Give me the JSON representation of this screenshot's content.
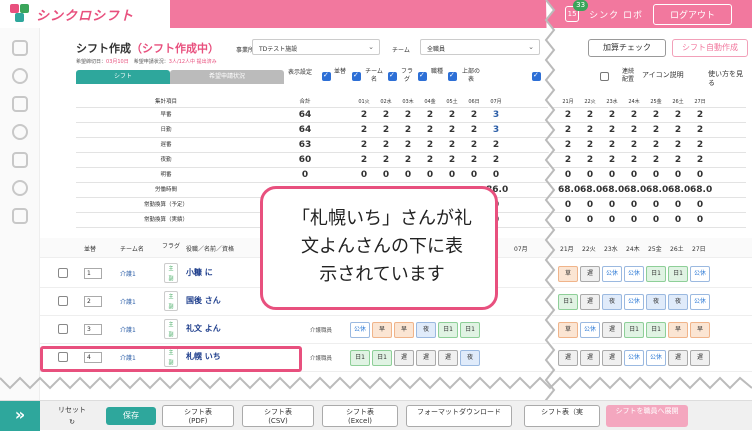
{
  "header": {
    "logo": "シンクロシフト",
    "notification_count": "33",
    "notification_label": "15",
    "user_name": "シンク ロボ",
    "logout": "ログアウト"
  },
  "toolbar": {
    "title": "シフト作成",
    "status": "（シフト作成中）",
    "office_label": "事業所",
    "office_value": "TDテスト施設",
    "team_label": "チーム",
    "team_value": "全職員",
    "deadline_label": "希望締切日：",
    "deadline_value": "03月10日",
    "request_label": "希望申請状況：",
    "request_value": "3人/12人中 提出済み",
    "tab_shift": "シフト",
    "tab_request": "希望申請状況",
    "display_label": "表示設定",
    "display_options": [
      "並替",
      "チーム名",
      "フラグ",
      "職種",
      "上部の表"
    ],
    "check_button": "加算チェック",
    "auto_button": "シフト自動作成",
    "fixed_label": "連続配置",
    "icon_label": "アイコン説明",
    "help_label": "使い方を見る"
  },
  "summary": {
    "header": {
      "label": "集計項目",
      "total": "合計"
    },
    "days": [
      "01火",
      "02水",
      "03木",
      "04金",
      "05土",
      "06日",
      "07月"
    ],
    "days_right": [
      "21月",
      "22火",
      "23水",
      "24木",
      "25金",
      "26土",
      "27日"
    ],
    "rows": [
      {
        "label": "早番",
        "total": "64",
        "values": [
          "2",
          "2",
          "2",
          "2",
          "2",
          "2",
          "3"
        ],
        "right": [
          "2",
          "2",
          "2",
          "2",
          "2",
          "2",
          "2"
        ]
      },
      {
        "label": "日勤",
        "total": "64",
        "values": [
          "2",
          "2",
          "2",
          "2",
          "2",
          "2",
          "3"
        ],
        "right": [
          "2",
          "2",
          "2",
          "2",
          "2",
          "2",
          "2"
        ]
      },
      {
        "label": "遅番",
        "total": "63",
        "values": [
          "2",
          "2",
          "2",
          "2",
          "2",
          "2",
          "2"
        ],
        "right": [
          "2",
          "2",
          "2",
          "2",
          "2",
          "2",
          "2"
        ]
      },
      {
        "label": "夜勤",
        "total": "60",
        "values": [
          "2",
          "2",
          "2",
          "2",
          "2",
          "2",
          "2"
        ],
        "right": [
          "2",
          "2",
          "2",
          "2",
          "2",
          "2",
          "2"
        ]
      },
      {
        "label": "明番",
        "total": "0",
        "values": [
          "0",
          "0",
          "0",
          "0",
          "0",
          "0",
          "0"
        ],
        "right": [
          "0",
          "0",
          "0",
          "0",
          "0",
          "0",
          "0"
        ]
      },
      {
        "label": "労働時間",
        "total": "",
        "values": [
          "",
          "",
          "",
          "",
          "",
          "",
          "86.0"
        ],
        "right": [
          "68.0",
          "68.0",
          "68.0",
          "68.0",
          "68.0",
          "68.0",
          "68.0"
        ]
      },
      {
        "label": "常勤換算（予定）",
        "total": "",
        "values": [
          "",
          "",
          "",
          "",
          "",
          "",
          "0"
        ],
        "right": [
          "0",
          "0",
          "0",
          "0",
          "0",
          "0",
          "0"
        ]
      },
      {
        "label": "常勤換算（実績）",
        "total": "",
        "values": [
          "",
          "",
          "",
          "",
          "",
          "",
          "0"
        ],
        "right": [
          "0",
          "0",
          "0",
          "0",
          "0",
          "0",
          "0"
        ]
      }
    ]
  },
  "staff_header": {
    "order": "並替",
    "team": "チーム名",
    "flag": "フラグ",
    "name": "役職／名前／資格",
    "day": "07月",
    "days_right": [
      "21月",
      "22火",
      "23水",
      "24木",
      "25金",
      "26土",
      "27日"
    ]
  },
  "staff": [
    {
      "no": "1",
      "team": "介護1",
      "name": "小糠 に",
      "shifts": [
        "休",
        "休",
        "休",
        "公休",
        "日1",
        "夜"
      ],
      "right": [
        "草",
        "遅",
        "公休",
        "公休",
        "日1",
        "日1",
        "公休"
      ]
    },
    {
      "no": "2",
      "team": "介護1",
      "name": "国後 さん",
      "shifts": [
        "",
        "",
        "",
        "",
        "",
        ""
      ],
      "right": [
        "日1",
        "遅",
        "夜",
        "公休",
        "夜",
        "夜",
        "公休"
      ]
    },
    {
      "no": "3",
      "team": "介護1",
      "name": "礼文 よん",
      "role": "介護職員",
      "shifts": [
        "公休",
        "早",
        "早",
        "夜",
        "日1",
        "日1"
      ],
      "right": [
        "草",
        "公休",
        "遅",
        "日1",
        "日1",
        "早",
        "早"
      ]
    },
    {
      "no": "4",
      "team": "介護1",
      "name": "札幌 いち",
      "role": "介護職員",
      "shifts": [
        "日1",
        "日1",
        "遅",
        "遅",
        "遅",
        "夜"
      ],
      "right": [
        "遅",
        "遅",
        "遅",
        "公休",
        "公休",
        "遅",
        "遅"
      ]
    }
  ],
  "flag_text": {
    "main": "主",
    "sub": "副"
  },
  "callout": "「札幌いち」さんが礼文よんさんの下に表示されています",
  "callout_lines": [
    "「札幌いち」さんが礼",
    "文よんさんの下に表",
    "示されています"
  ],
  "bottom": {
    "reset": "リセット",
    "save": "保存",
    "pdf": "シフト表\n(PDF)",
    "csv": "シフト表\n(CSV)",
    "excel": "シフト表\n(Excel)",
    "format": "フォーマットダウンロード",
    "export": "シフト表（実",
    "deploy": "シフトを職員へ展開"
  }
}
